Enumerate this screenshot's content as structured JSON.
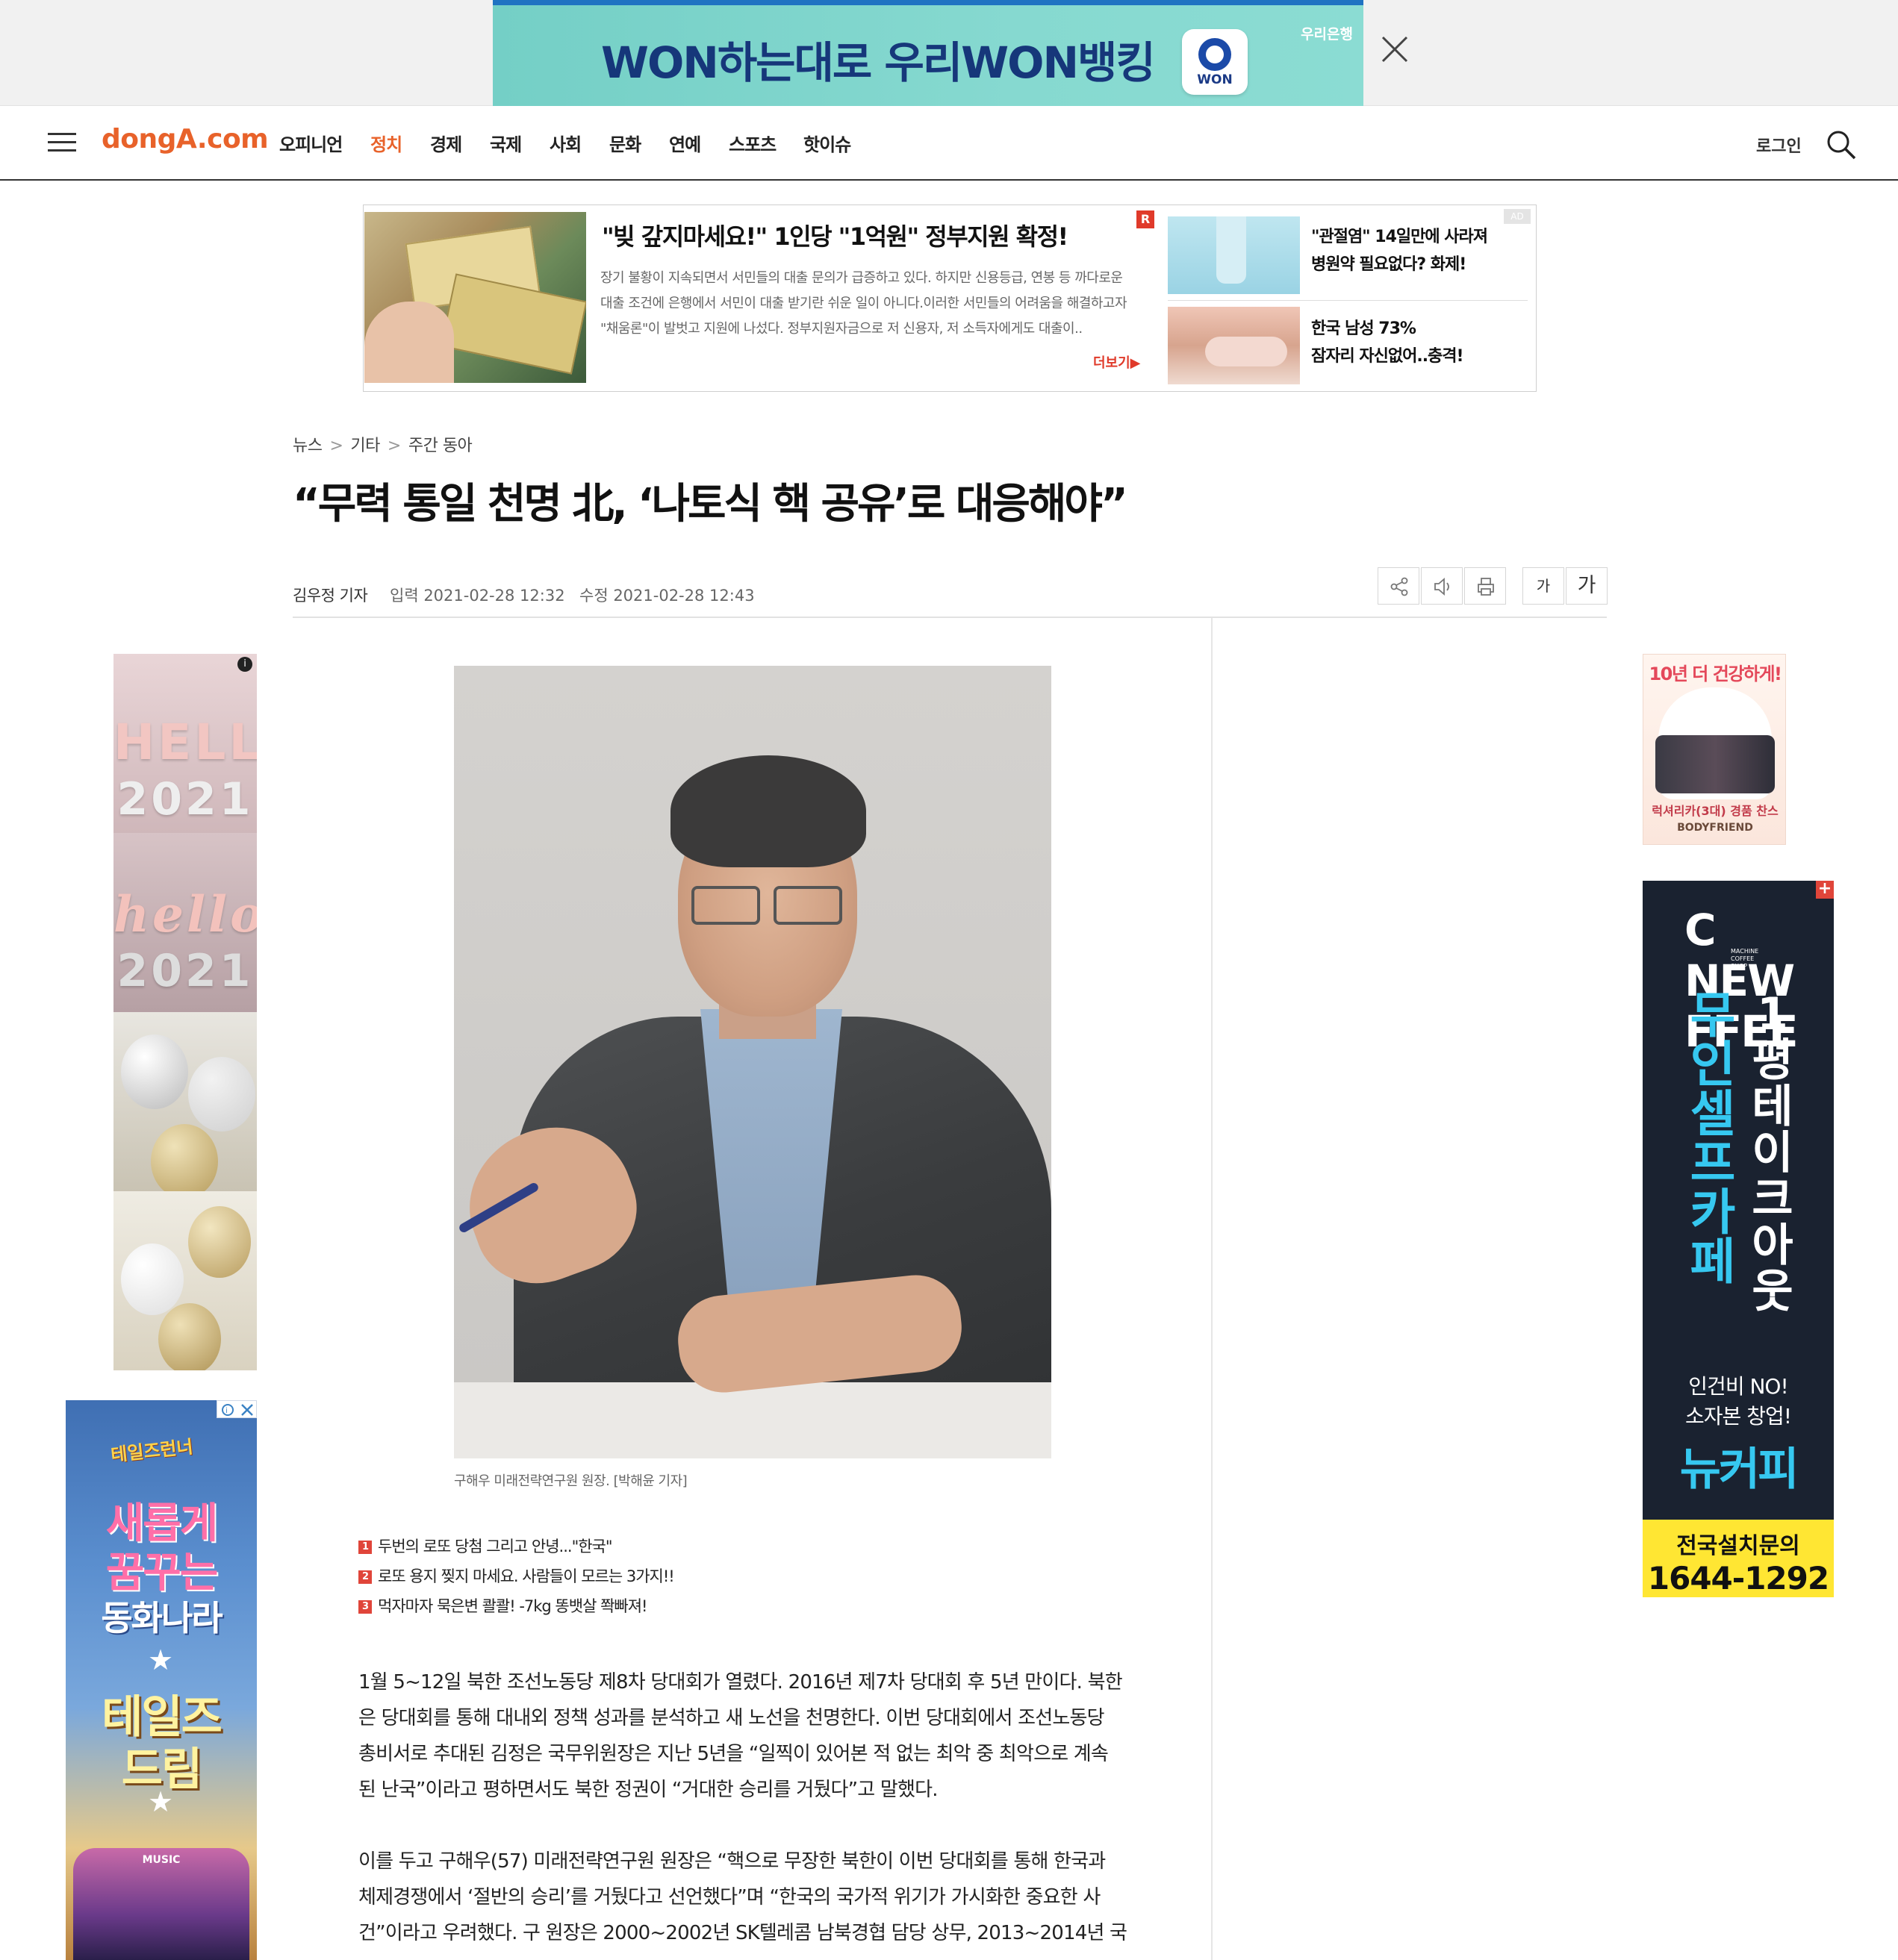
{
  "top_ad": {
    "headline": "WON하는대로 우리WON뱅킹",
    "badge": "WON",
    "bank": "우리은행"
  },
  "nav": {
    "logo": "dongA.com",
    "items": [
      "오피니언",
      "정치",
      "경제",
      "국제",
      "사회",
      "문화",
      "연예",
      "스포츠",
      "핫이슈"
    ],
    "active_item": "정치",
    "login": "로그인"
  },
  "native_ad": {
    "title": "\"빚 갚지마세요!\" 1인당 \"1억원\" 정부지원 확정!",
    "body": "장기 불황이 지속되면서 서민들의 대출 문의가 급증하고 있다. 하지만 신용등급, 연봉 등 까다로운 대출 조건에 은행에서 서민이 대출 받기란 쉬운 일이 아니다.이러한 서민들의 어려움을 해결하고자 \"채움론\"이 발벗고 지원에 나섰다. 정부지원자금으로 저 신용자, 저 소득자에게도 대출이..",
    "more": "더보기▶",
    "r_badge": "R",
    "ad_tag": "AD",
    "side_items": [
      {
        "line1": "\"관절염\" 14일만에 사라져",
        "line2": "병원약 필요없다? 화제!"
      },
      {
        "line1": "한국 남성 73%",
        "line2": "잠자리 자신없어..충격!"
      }
    ]
  },
  "breadcrumb": [
    "뉴스",
    "기타",
    "주간 동아"
  ],
  "article": {
    "title": "“무력 통일 천명 北, ‘나토식 핵 공유’로 대응해야”",
    "author": "김우정 기자",
    "published": "입력 2021-02-28 12:32",
    "modified": "수정 2021-02-28 12:43",
    "font_small": "가",
    "font_large": "가",
    "photo_caption": "구해우 미래전략연구원 원장. [박해윤 기자]",
    "paragraphs": [
      {
        "lines": [
          "1월 5~12일 북한 조선노동당 제8차 당대회가 열렸다. 2016년 제7차 당대회 후 5년 만이다. 북한",
          "은 당대회를 통해 대내외 정책 성과를 분석하고 새 노선을 천명한다. 이번 당대회에서 조선노동당",
          "총비서로 추대된 김정은 국무위원장은 지난 5년을 “일찍이 있어본 적 없는 최악 중 최악으로 계속",
          "된 난국”이라고 평하면서도 북한 정권이 “거대한 승리를 거뒀다”고 말했다."
        ]
      },
      {
        "lines": [
          "이를 두고 구해우(57) 미래전략연구원 원장은 “핵으로 무장한 북한이 이번 당대회를 통해 한국과",
          "체제경쟁에서 ‘절반의 승리’를 거뒀다고 선언했다”며 “한국의 국가적 위기가 가시화한 중요한 사",
          "건”이라고 우려했다. 구 원장은 2000~2002년 SK텔레콤 남북경협 담당 상무, 2013~2014년 국"
        ]
      }
    ]
  },
  "related_links": [
    {
      "num": "1",
      "text": "두번의 로또 당첨 그리고 안녕...\"한국\""
    },
    {
      "num": "2",
      "text": "로또 용지 찢지 마세요. 사람들이 모르는 3가지!!"
    },
    {
      "num": "3",
      "text": "먹자마자 묵은변 콸콸! -7kg 똥뱃살 쫙빠져!"
    }
  ],
  "left_ads": {
    "balloon_text_1": "HELLO",
    "balloon_text_2": "2021",
    "balloon_text_3": "hello",
    "balloon_text_4": "2021",
    "game_logo": "테일즈런너",
    "game_line1": "새롭게",
    "game_line2": "꿈꾸는",
    "game_line3": "동화나라",
    "game_line4": "테일즈",
    "game_line5": "드림",
    "stage_label": "MUSIC"
  },
  "right_ads": {
    "health_header": "10년 더 건강하게!",
    "health_footer": "럭셔리카(3대) 경품 찬스",
    "health_brand": "BODYFRIEND",
    "cafe_brand": "C NEW FFEE",
    "cafe_brand_sub": [
      "MACHINE",
      "COFFEE",
      "SHOP"
    ],
    "cafe_col1": [
      "무",
      "인",
      "셀",
      "프",
      "카",
      "페"
    ],
    "cafe_col2": [
      "1",
      "평",
      "테",
      "이",
      "크",
      "아",
      "웃"
    ],
    "cafe_tag1": "인건비 NO!",
    "cafe_tag2": "소자본 창업!",
    "cafe_name": "뉴커피",
    "cafe_cta": "전국설치문의",
    "cafe_phone": "1644-1292"
  },
  "colors": {
    "brand": "#e8622a",
    "related_num": "#e0453a",
    "ad_cyan": "#36c8f0",
    "ad_yellow": "#ffe633"
  },
  "icons": [
    "close-icon",
    "menu-icon",
    "search-icon",
    "share-icon",
    "speaker-icon",
    "print-icon",
    "info-icon",
    "adchoices-icon"
  ]
}
